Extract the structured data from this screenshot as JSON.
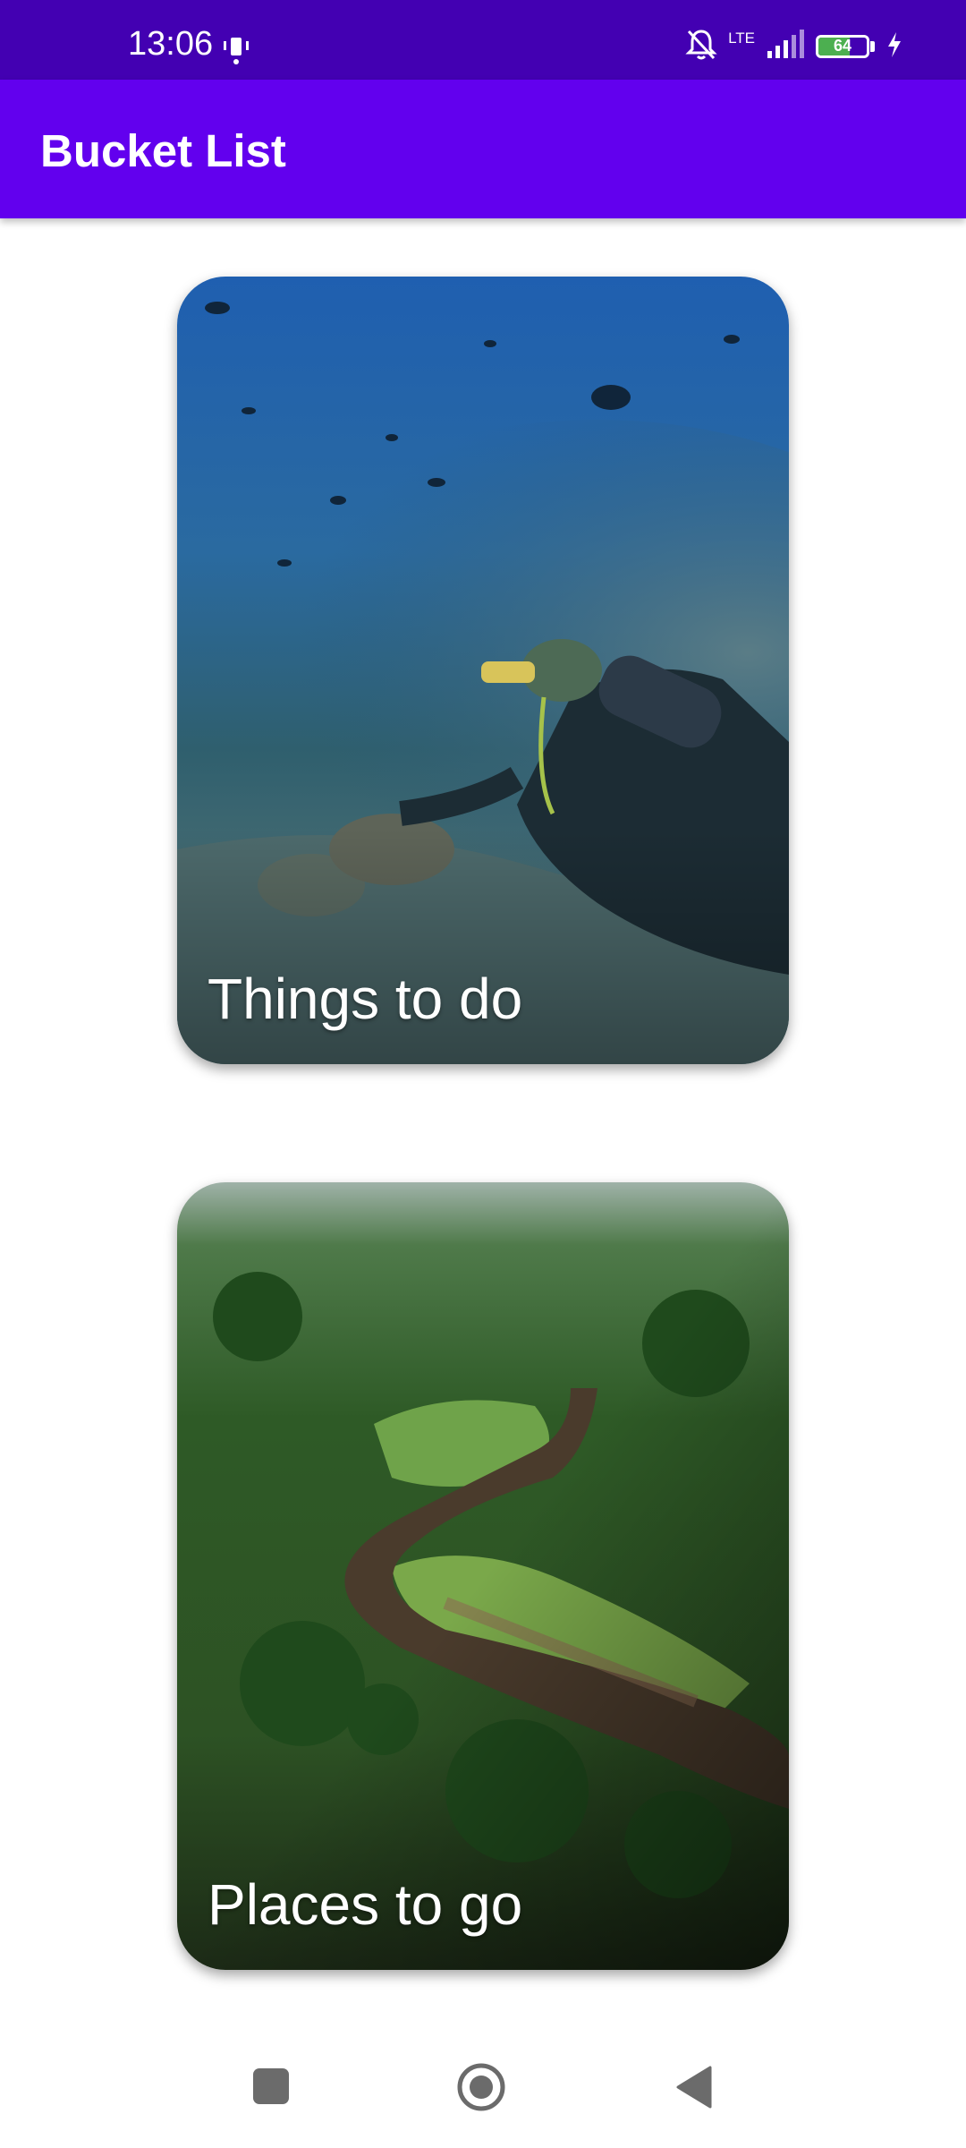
{
  "status_bar": {
    "time": "13:06",
    "network": "LTE",
    "battery": "64",
    "battery_level": 0.64,
    "icons": [
      "vibrate-icon",
      "mute-bell-icon",
      "signal-icon",
      "battery-icon",
      "charging-icon"
    ]
  },
  "app_bar": {
    "title": "Bucket List"
  },
  "cards": [
    {
      "label": "Things to do",
      "image": "scuba-diver-with-fish-school"
    },
    {
      "label": "Places to go",
      "image": "aerial-river-through-forest"
    }
  ],
  "nav_bar": {
    "icons": [
      "recents-square-icon",
      "home-circle-icon",
      "back-triangle-icon"
    ]
  },
  "colors": {
    "status_bar": "#4300b2",
    "app_bar": "#6200ee",
    "background": "#ffffff",
    "battery_fill": "#4caf50"
  }
}
